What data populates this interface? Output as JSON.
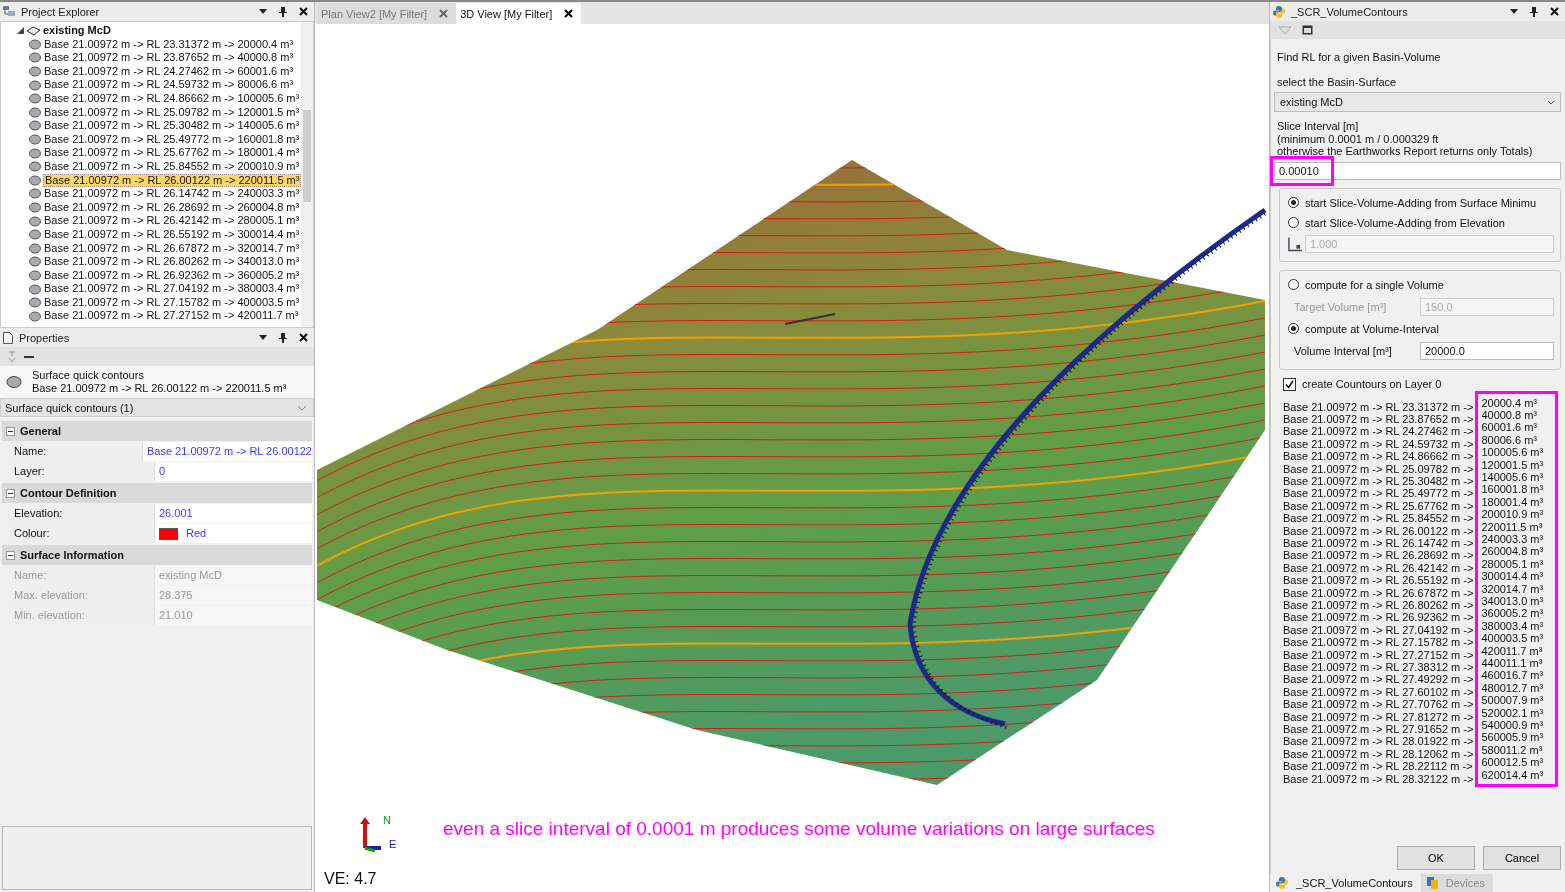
{
  "project_explorer": {
    "title": "Project Explorer",
    "tree": [
      {
        "label": "existing McD",
        "expanded": true,
        "children": [
          {
            "label": "Base 21.00972 m -> RL 23.31372 m -> 20000.4 m³",
            "selected": false
          },
          {
            "label": "Base 21.00972 m -> RL 23.87652 m -> 40000.8 m³",
            "selected": false
          },
          {
            "label": "Base 21.00972 m -> RL 24.27462 m -> 60001.6 m³",
            "selected": false
          },
          {
            "label": "Base 21.00972 m -> RL 24.59732 m -> 80006.6 m³",
            "selected": false
          },
          {
            "label": "Base 21.00972 m -> RL 24.86662 m -> 100005.6 m³",
            "selected": false
          },
          {
            "label": "Base 21.00972 m -> RL 25.09782 m -> 120001.5 m³",
            "selected": false
          },
          {
            "label": "Base 21.00972 m -> RL 25.30482 m -> 140005.6 m³",
            "selected": false
          },
          {
            "label": "Base 21.00972 m -> RL 25.49772 m -> 160001.8 m³",
            "selected": false
          },
          {
            "label": "Base 21.00972 m -> RL 25.67762 m -> 180001.4 m³",
            "selected": false
          },
          {
            "label": "Base 21.00972 m -> RL 25.84552 m -> 200010.9 m³",
            "selected": false
          },
          {
            "label": "Base 21.00972 m -> RL 26.00122 m -> 220011.5 m³",
            "selected": true
          },
          {
            "label": "Base 21.00972 m -> RL 26.14742 m -> 240003.3 m³",
            "selected": false
          },
          {
            "label": "Base 21.00972 m -> RL 26.28692 m -> 260004.8 m³",
            "selected": false
          },
          {
            "label": "Base 21.00972 m -> RL 26.42142 m -> 280005.1 m³",
            "selected": false
          },
          {
            "label": "Base 21.00972 m -> RL 26.55192 m -> 300014.4 m³",
            "selected": false
          },
          {
            "label": "Base 21.00972 m -> RL 26.67872 m -> 320014.7 m³",
            "selected": false
          },
          {
            "label": "Base 21.00972 m -> RL 26.80262 m -> 340013.0 m³",
            "selected": false
          },
          {
            "label": "Base 21.00972 m -> RL 26.92362 m -> 360005.2 m³",
            "selected": false
          },
          {
            "label": "Base 21.00972 m -> RL 27.04192 m -> 380003.4 m³",
            "selected": false
          },
          {
            "label": "Base 21.00972 m -> RL 27.15782 m -> 400003.5 m³",
            "selected": false
          },
          {
            "label": "Base 21.00972 m -> RL 27.27152 m -> 420011.7 m³",
            "selected": false
          }
        ]
      }
    ]
  },
  "properties": {
    "title": "Properties",
    "summary": {
      "title": "Surface quick contours",
      "subtitle": "Base 21.00972 m -> RL 26.00122 m -> 220011.5 m³"
    },
    "selector": "Surface quick contours (1)",
    "sections": [
      {
        "title": "General",
        "expanded": true,
        "rows": [
          {
            "label": "Name:",
            "value": "Base 21.00972 m -> RL 26.00122",
            "disabled": false
          },
          {
            "label": "Layer:",
            "value": "0",
            "disabled": false
          }
        ]
      },
      {
        "title": "Contour Definition",
        "expanded": true,
        "rows": [
          {
            "label": "Elevation:",
            "value": "26.001",
            "disabled": false
          },
          {
            "label": "Colour:",
            "value": "Red",
            "disabled": false,
            "color": "#ff0000"
          }
        ]
      },
      {
        "title": "Surface Information",
        "expanded": true,
        "rows": [
          {
            "label": "Name:",
            "value": "existing McD",
            "disabled": true
          },
          {
            "label": "Max. elevation:",
            "value": "28.375",
            "disabled": true
          },
          {
            "label": "Min. elevation:",
            "value": "21.010",
            "disabled": true
          }
        ]
      }
    ]
  },
  "tabs": [
    {
      "label": "Plan View2 [My Filter]",
      "selected": false
    },
    {
      "label": "3D View [My Filter]",
      "selected": true
    }
  ],
  "view": {
    "axis_labels": [
      "N",
      "E"
    ],
    "annotation": "even a slice interval of 0.0001 m produces some volume variations on large surfaces",
    "ve": "VE: 4.7"
  },
  "script_panel": {
    "title": "_SCR_VolumeContours",
    "heading": "Find RL for a given Basin-Volume",
    "surface_label": "select the Basin-Surface",
    "surface": "existing McD",
    "slice_label": [
      "Slice Interval [m]",
      "(minimum 0.0001 m / 0.000329 ft",
      "otherwise the Earthworks Report returns only Totals)"
    ],
    "slice_value": "0.00010",
    "start_options": [
      {
        "label": "start Slice-Volume-Adding from Surface Minimu",
        "selected": true
      },
      {
        "label": "start Slice-Volume-Adding from Elevation",
        "selected": false
      }
    ],
    "elevation": {
      "value": "1.000",
      "disabled": true
    },
    "compute_options": [
      {
        "label": "compute for a single Volume",
        "selected": false,
        "field_label": "Target Volume [m³]",
        "value": "150.0",
        "disabled": true
      },
      {
        "label": "compute at Volume-Interval",
        "selected": true,
        "field_label": "Volume Interval [m³]",
        "value": "20000.0",
        "disabled": false
      }
    ],
    "layer_checkbox": {
      "label": "create Countours on Layer 0",
      "checked": true
    },
    "results": [
      {
        "text": "Base 21.00972 m -> RL 23.31372 m ->",
        "volume": "20000.4 m³"
      },
      {
        "text": "Base 21.00972 m -> RL 23.87652 m ->",
        "volume": "40000.8 m³"
      },
      {
        "text": "Base 21.00972 m -> RL 24.27462 m ->",
        "volume": "60001.6 m³"
      },
      {
        "text": "Base 21.00972 m -> RL 24.59732 m ->",
        "volume": "80006.6 m³"
      },
      {
        "text": "Base 21.00972 m -> RL 24.86662 m ->",
        "volume": "100005.6 m³"
      },
      {
        "text": "Base 21.00972 m -> RL 25.09782 m ->",
        "volume": "120001.5 m³"
      },
      {
        "text": "Base 21.00972 m -> RL 25.30482 m ->",
        "volume": "140005.6 m³"
      },
      {
        "text": "Base 21.00972 m -> RL 25.49772 m ->",
        "volume": "160001.8 m³"
      },
      {
        "text": "Base 21.00972 m -> RL 25.67762 m ->",
        "volume": "180001.4 m³"
      },
      {
        "text": "Base 21.00972 m -> RL 25.84552 m ->",
        "volume": "200010.9 m³"
      },
      {
        "text": "Base 21.00972 m -> RL 26.00122 m ->",
        "volume": "220011.5 m³"
      },
      {
        "text": "Base 21.00972 m -> RL 26.14742 m ->",
        "volume": "240003.3 m³"
      },
      {
        "text": "Base 21.00972 m -> RL 26.28692 m ->",
        "volume": "260004.8 m³"
      },
      {
        "text": "Base 21.00972 m -> RL 26.42142 m ->",
        "volume": "280005.1 m³"
      },
      {
        "text": "Base 21.00972 m -> RL 26.55192 m ->",
        "volume": "300014.4 m³"
      },
      {
        "text": "Base 21.00972 m -> RL 26.67872 m ->",
        "volume": "320014.7 m³"
      },
      {
        "text": "Base 21.00972 m -> RL 26.80262 m ->",
        "volume": "340013.0 m³"
      },
      {
        "text": "Base 21.00972 m -> RL 26.92362 m ->",
        "volume": "360005.2 m³"
      },
      {
        "text": "Base 21.00972 m -> RL 27.04192 m ->",
        "volume": "380003.4 m³"
      },
      {
        "text": "Base 21.00972 m -> RL 27.15782 m ->",
        "volume": "400003.5 m³"
      },
      {
        "text": "Base 21.00972 m -> RL 27.27152 m ->",
        "volume": "420011.7 m³"
      },
      {
        "text": "Base 21.00972 m -> RL 27.38312 m ->",
        "volume": "440011.1 m³"
      },
      {
        "text": "Base 21.00972 m -> RL 27.49292 m ->",
        "volume": "460016.7 m³"
      },
      {
        "text": "Base 21.00972 m -> RL 27.60102 m ->",
        "volume": "480012.7 m³"
      },
      {
        "text": "Base 21.00972 m -> RL 27.70762 m ->",
        "volume": "500007.9 m³"
      },
      {
        "text": "Base 21.00972 m -> RL 27.81272 m ->",
        "volume": "520002.1 m³"
      },
      {
        "text": "Base 21.00972 m -> RL 27.91652 m ->",
        "volume": "540000.9 m³"
      },
      {
        "text": "Base 21.00972 m -> RL 28.01922 m ->",
        "volume": "560005.9 m³"
      },
      {
        "text": "Base 21.00972 m -> RL 28.12062 m ->",
        "volume": "580011.2 m³"
      },
      {
        "text": "Base 21.00972 m -> RL 28.22112 m ->",
        "volume": "600012.5 m³"
      },
      {
        "text": "Base 21.00972 m -> RL 28.32122 m ->",
        "volume": "620014.4 m³"
      }
    ],
    "buttons": [
      "OK",
      "Cancel"
    ],
    "bottom_tabs": [
      {
        "label": "_SCR_VolumeContours",
        "selected": true
      },
      {
        "label": "Devices",
        "selected": false
      }
    ]
  }
}
